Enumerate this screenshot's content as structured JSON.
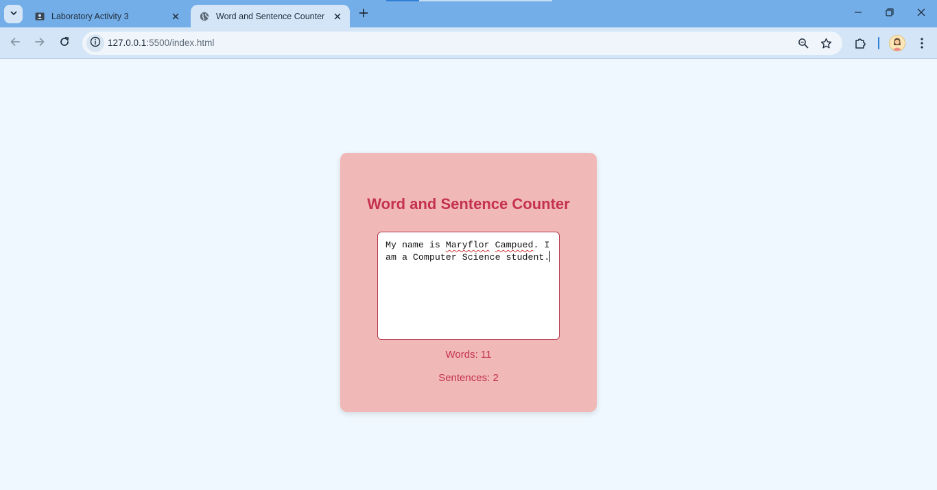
{
  "browser": {
    "tabs": [
      {
        "title": "Laboratory Activity 3",
        "active": false,
        "icon": "contact-card-icon"
      },
      {
        "title": "Word and Sentence Counter",
        "active": true,
        "icon": "globe-icon"
      }
    ],
    "url_host": "127.0.0.1",
    "url_rest": ":5500/index.html",
    "colors": {
      "tabstrip": "#74aee8",
      "toolbar": "#d3e5f7",
      "accent": "#2f7fd6"
    }
  },
  "page": {
    "title": "Word and Sentence Counter",
    "textarea": {
      "segments": [
        {
          "text": "My name is ",
          "misspelled": false
        },
        {
          "text": "Maryflor",
          "misspelled": true
        },
        {
          "text": " ",
          "misspelled": false
        },
        {
          "text": "Campued",
          "misspelled": true
        },
        {
          "text": ". I am a Computer Science student.",
          "misspelled": false
        }
      ]
    },
    "words_label": "Words:",
    "words_count": "11",
    "sentences_label": "Sentences:",
    "sentences_count": "2",
    "colors": {
      "background": "#eff8fe",
      "card": "#f0b8b6",
      "accent": "#c5324f"
    }
  }
}
